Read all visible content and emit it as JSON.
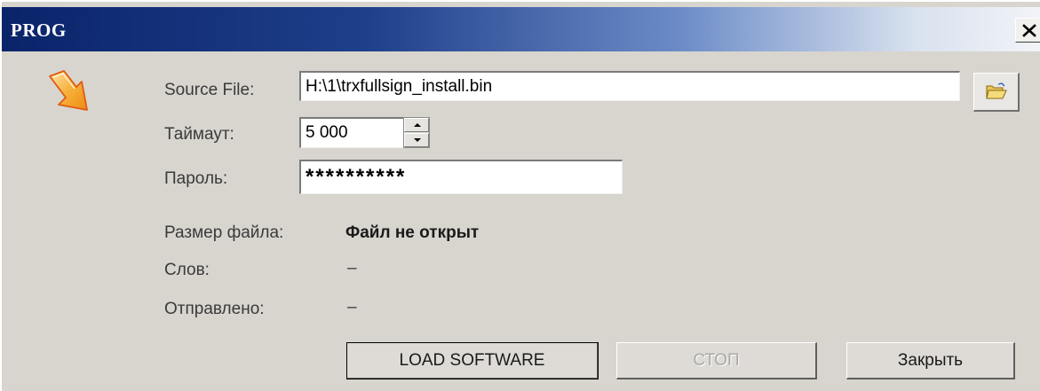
{
  "window": {
    "title": "PROG"
  },
  "icons": {
    "arrow": "arrow-pointer-icon",
    "close": "close-icon",
    "browse": "folder-open-icon"
  },
  "form": {
    "source_file_label": "Source File:",
    "source_file_value": "H:\\1\\trxfullsign_install.bin",
    "timeout_label": "Таймаут:",
    "timeout_value": "5 000",
    "password_label": "Пароль:",
    "password_value": "**********"
  },
  "info": {
    "file_size_label": "Размер файла:",
    "file_size_value": "Файл не открыт",
    "words_label": "Слов:",
    "words_value": "–",
    "sent_label": "Отправлено:",
    "sent_value": "–"
  },
  "buttons": {
    "load_label": "LOAD SOFTWARE",
    "stop_label": "СТОП",
    "close_label": "Закрыть"
  },
  "colors": {
    "title_gradient_start": "#0a246a",
    "window_bg": "#d8d5cf",
    "arrow_orange": "#f5a32a"
  }
}
